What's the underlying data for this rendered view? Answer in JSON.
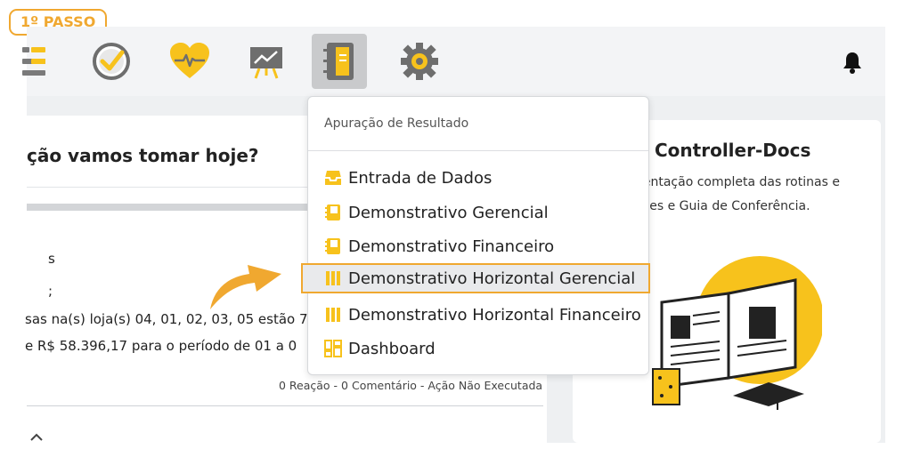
{
  "step_badge": "1º PASSO",
  "colors": {
    "accent": "#f0a830",
    "icon_yellow": "#f7c21c",
    "dark_icon": "#6e6e6e"
  },
  "topbar": {
    "icons": [
      "menu-icon",
      "clock-check-icon",
      "heart-pulse-icon",
      "presentation-chart-icon",
      "notebook-icon",
      "gear-icon"
    ],
    "active": "notebook-icon",
    "bell": "bell-icon"
  },
  "left_card": {
    "title": "ção vamos tomar hoje?",
    "frag1": "s",
    "frag2": ";",
    "line1": "sas na(s) loja(s) 04, 01, 02, 03, 05 estão 7",
    "line2": "e R$ 58.396,17 para o período de 01 a 0",
    "meta": "0 Reação - 0 Comentário - Ação Não Executada"
  },
  "right_card": {
    "title": "Controller-Docs",
    "line1": "nentação completa das rotinas e",
    "line2": "ções e Guia de Conferência."
  },
  "dropdown": {
    "header": "Apuração de Resultado",
    "items": [
      {
        "label": "Entrada de Dados",
        "icon": "inbox-icon"
      },
      {
        "label": "Demonstrativo Gerencial",
        "icon": "book-icon"
      },
      {
        "label": "Demonstrativo Financeiro",
        "icon": "book-icon"
      },
      {
        "label": "Demonstrativo Horizontal Gerencial",
        "icon": "columns-icon"
      },
      {
        "label": "Demonstrativo Horizontal Financeiro",
        "icon": "columns-icon"
      },
      {
        "label": "Dashboard",
        "icon": "dashboard-icon"
      }
    ],
    "highlighted": "Demonstrativo Horizontal Gerencial"
  }
}
